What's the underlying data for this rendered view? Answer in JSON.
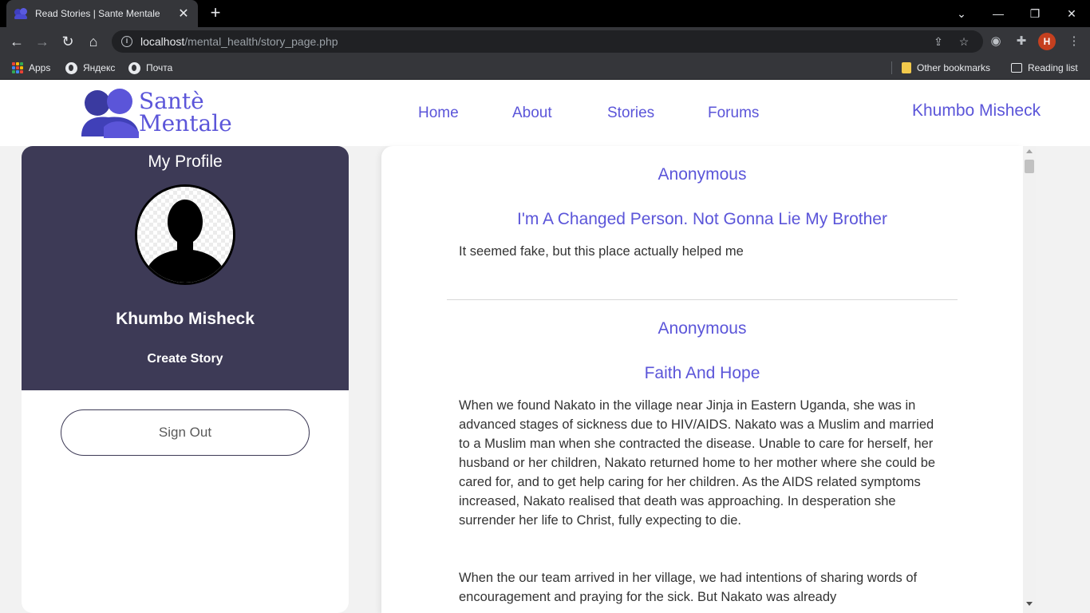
{
  "browser": {
    "tab_title": "Read Stories | Sante Mentale",
    "tab_close": "✕",
    "new_tab": "+",
    "url_host": "localhost",
    "url_path": "/mental_health/story_page.php",
    "profile_initial": "H",
    "bookmarks": [
      {
        "label": "Apps",
        "icon": "apps-grid-icon"
      },
      {
        "label": "Яндекс",
        "icon": "globe-icon"
      },
      {
        "label": "Почта",
        "icon": "globe-icon"
      }
    ],
    "other_bookmarks": "Other bookmarks",
    "reading_list": "Reading list"
  },
  "site": {
    "logo_line1": "Santè",
    "logo_line2": "Mentale",
    "nav": [
      "Home",
      "About",
      "Stories",
      "Forums"
    ],
    "user_name": "Khumbo Misheck",
    "brand_color": "#5b55d9",
    "panel_color": "#3d3a56"
  },
  "profile": {
    "heading": "My Profile",
    "name": "Khumbo Misheck",
    "create_story": "Create Story",
    "sign_out": "Sign Out"
  },
  "stories": [
    {
      "author": "Anonymous",
      "title": "I'm A Changed Person. Not Gonna Lie My Brother",
      "body": "It seemed fake, but this place actually helped me"
    },
    {
      "author": "Anonymous",
      "title": "Faith And Hope",
      "body": "When we found Nakato in the village near Jinja in Eastern Uganda, she was in advanced stages of sickness due to HIV/AIDS. Nakato was a Muslim and married to a Muslim man when she contracted the disease. Unable to care for herself, her husband or her children, Nakato returned home to her mother where she could be cared for, and to get help caring for her children. As the AIDS related symptoms increased, Nakato realised that death was approaching. In desperation she surrender her life to Christ, fully expecting to die.",
      "body2": "When the our team arrived in her village, we had intentions of sharing words of encouragement and praying for the sick. But Nakato was already"
    }
  ]
}
